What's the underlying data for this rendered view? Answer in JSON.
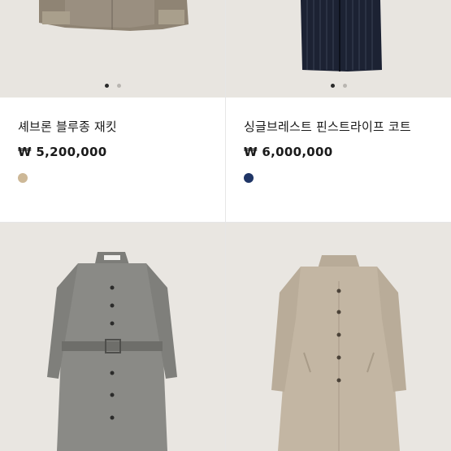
{
  "products": [
    {
      "title": "셰브론 블루종 재킷",
      "price": "₩ 5,200,000",
      "swatch_color": "#cdb897",
      "image_icon": "jacket-image",
      "carousel": {
        "total": 2,
        "active": 1
      }
    },
    {
      "title": "싱글브레스트 핀스트라이프 코트",
      "price": "₩ 6,000,000",
      "swatch_color": "#1f3566",
      "image_icon": "coat-image",
      "carousel": {
        "total": 2,
        "active": 1
      }
    },
    {
      "title": "",
      "price": "",
      "image_icon": "gray-belted-coat-image"
    },
    {
      "title": "",
      "price": "",
      "image_icon": "beige-long-coat-image"
    }
  ]
}
